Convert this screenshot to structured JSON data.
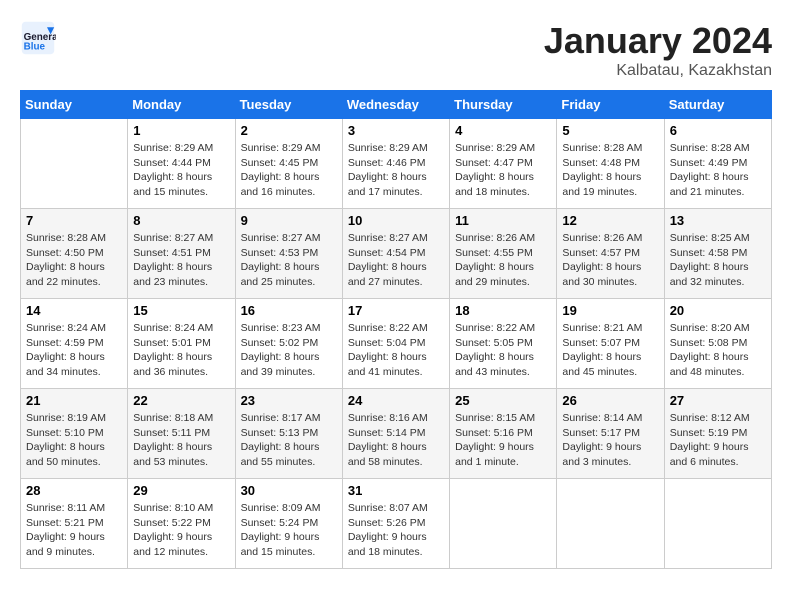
{
  "header": {
    "logo_text_general": "General",
    "logo_text_blue": "Blue",
    "month_title": "January 2024",
    "location": "Kalbatau, Kazakhstan"
  },
  "days_of_week": [
    "Sunday",
    "Monday",
    "Tuesday",
    "Wednesday",
    "Thursday",
    "Friday",
    "Saturday"
  ],
  "weeks": [
    [
      {
        "day": "",
        "sunrise": "",
        "sunset": "",
        "daylight": ""
      },
      {
        "day": "1",
        "sunrise": "Sunrise: 8:29 AM",
        "sunset": "Sunset: 4:44 PM",
        "daylight": "Daylight: 8 hours and 15 minutes."
      },
      {
        "day": "2",
        "sunrise": "Sunrise: 8:29 AM",
        "sunset": "Sunset: 4:45 PM",
        "daylight": "Daylight: 8 hours and 16 minutes."
      },
      {
        "day": "3",
        "sunrise": "Sunrise: 8:29 AM",
        "sunset": "Sunset: 4:46 PM",
        "daylight": "Daylight: 8 hours and 17 minutes."
      },
      {
        "day": "4",
        "sunrise": "Sunrise: 8:29 AM",
        "sunset": "Sunset: 4:47 PM",
        "daylight": "Daylight: 8 hours and 18 minutes."
      },
      {
        "day": "5",
        "sunrise": "Sunrise: 8:28 AM",
        "sunset": "Sunset: 4:48 PM",
        "daylight": "Daylight: 8 hours and 19 minutes."
      },
      {
        "day": "6",
        "sunrise": "Sunrise: 8:28 AM",
        "sunset": "Sunset: 4:49 PM",
        "daylight": "Daylight: 8 hours and 21 minutes."
      }
    ],
    [
      {
        "day": "7",
        "sunrise": "Sunrise: 8:28 AM",
        "sunset": "Sunset: 4:50 PM",
        "daylight": "Daylight: 8 hours and 22 minutes."
      },
      {
        "day": "8",
        "sunrise": "Sunrise: 8:27 AM",
        "sunset": "Sunset: 4:51 PM",
        "daylight": "Daylight: 8 hours and 23 minutes."
      },
      {
        "day": "9",
        "sunrise": "Sunrise: 8:27 AM",
        "sunset": "Sunset: 4:53 PM",
        "daylight": "Daylight: 8 hours and 25 minutes."
      },
      {
        "day": "10",
        "sunrise": "Sunrise: 8:27 AM",
        "sunset": "Sunset: 4:54 PM",
        "daylight": "Daylight: 8 hours and 27 minutes."
      },
      {
        "day": "11",
        "sunrise": "Sunrise: 8:26 AM",
        "sunset": "Sunset: 4:55 PM",
        "daylight": "Daylight: 8 hours and 29 minutes."
      },
      {
        "day": "12",
        "sunrise": "Sunrise: 8:26 AM",
        "sunset": "Sunset: 4:57 PM",
        "daylight": "Daylight: 8 hours and 30 minutes."
      },
      {
        "day": "13",
        "sunrise": "Sunrise: 8:25 AM",
        "sunset": "Sunset: 4:58 PM",
        "daylight": "Daylight: 8 hours and 32 minutes."
      }
    ],
    [
      {
        "day": "14",
        "sunrise": "Sunrise: 8:24 AM",
        "sunset": "Sunset: 4:59 PM",
        "daylight": "Daylight: 8 hours and 34 minutes."
      },
      {
        "day": "15",
        "sunrise": "Sunrise: 8:24 AM",
        "sunset": "Sunset: 5:01 PM",
        "daylight": "Daylight: 8 hours and 36 minutes."
      },
      {
        "day": "16",
        "sunrise": "Sunrise: 8:23 AM",
        "sunset": "Sunset: 5:02 PM",
        "daylight": "Daylight: 8 hours and 39 minutes."
      },
      {
        "day": "17",
        "sunrise": "Sunrise: 8:22 AM",
        "sunset": "Sunset: 5:04 PM",
        "daylight": "Daylight: 8 hours and 41 minutes."
      },
      {
        "day": "18",
        "sunrise": "Sunrise: 8:22 AM",
        "sunset": "Sunset: 5:05 PM",
        "daylight": "Daylight: 8 hours and 43 minutes."
      },
      {
        "day": "19",
        "sunrise": "Sunrise: 8:21 AM",
        "sunset": "Sunset: 5:07 PM",
        "daylight": "Daylight: 8 hours and 45 minutes."
      },
      {
        "day": "20",
        "sunrise": "Sunrise: 8:20 AM",
        "sunset": "Sunset: 5:08 PM",
        "daylight": "Daylight: 8 hours and 48 minutes."
      }
    ],
    [
      {
        "day": "21",
        "sunrise": "Sunrise: 8:19 AM",
        "sunset": "Sunset: 5:10 PM",
        "daylight": "Daylight: 8 hours and 50 minutes."
      },
      {
        "day": "22",
        "sunrise": "Sunrise: 8:18 AM",
        "sunset": "Sunset: 5:11 PM",
        "daylight": "Daylight: 8 hours and 53 minutes."
      },
      {
        "day": "23",
        "sunrise": "Sunrise: 8:17 AM",
        "sunset": "Sunset: 5:13 PM",
        "daylight": "Daylight: 8 hours and 55 minutes."
      },
      {
        "day": "24",
        "sunrise": "Sunrise: 8:16 AM",
        "sunset": "Sunset: 5:14 PM",
        "daylight": "Daylight: 8 hours and 58 minutes."
      },
      {
        "day": "25",
        "sunrise": "Sunrise: 8:15 AM",
        "sunset": "Sunset: 5:16 PM",
        "daylight": "Daylight: 9 hours and 1 minute."
      },
      {
        "day": "26",
        "sunrise": "Sunrise: 8:14 AM",
        "sunset": "Sunset: 5:17 PM",
        "daylight": "Daylight: 9 hours and 3 minutes."
      },
      {
        "day": "27",
        "sunrise": "Sunrise: 8:12 AM",
        "sunset": "Sunset: 5:19 PM",
        "daylight": "Daylight: 9 hours and 6 minutes."
      }
    ],
    [
      {
        "day": "28",
        "sunrise": "Sunrise: 8:11 AM",
        "sunset": "Sunset: 5:21 PM",
        "daylight": "Daylight: 9 hours and 9 minutes."
      },
      {
        "day": "29",
        "sunrise": "Sunrise: 8:10 AM",
        "sunset": "Sunset: 5:22 PM",
        "daylight": "Daylight: 9 hours and 12 minutes."
      },
      {
        "day": "30",
        "sunrise": "Sunrise: 8:09 AM",
        "sunset": "Sunset: 5:24 PM",
        "daylight": "Daylight: 9 hours and 15 minutes."
      },
      {
        "day": "31",
        "sunrise": "Sunrise: 8:07 AM",
        "sunset": "Sunset: 5:26 PM",
        "daylight": "Daylight: 9 hours and 18 minutes."
      },
      {
        "day": "",
        "sunrise": "",
        "sunset": "",
        "daylight": ""
      },
      {
        "day": "",
        "sunrise": "",
        "sunset": "",
        "daylight": ""
      },
      {
        "day": "",
        "sunrise": "",
        "sunset": "",
        "daylight": ""
      }
    ]
  ]
}
